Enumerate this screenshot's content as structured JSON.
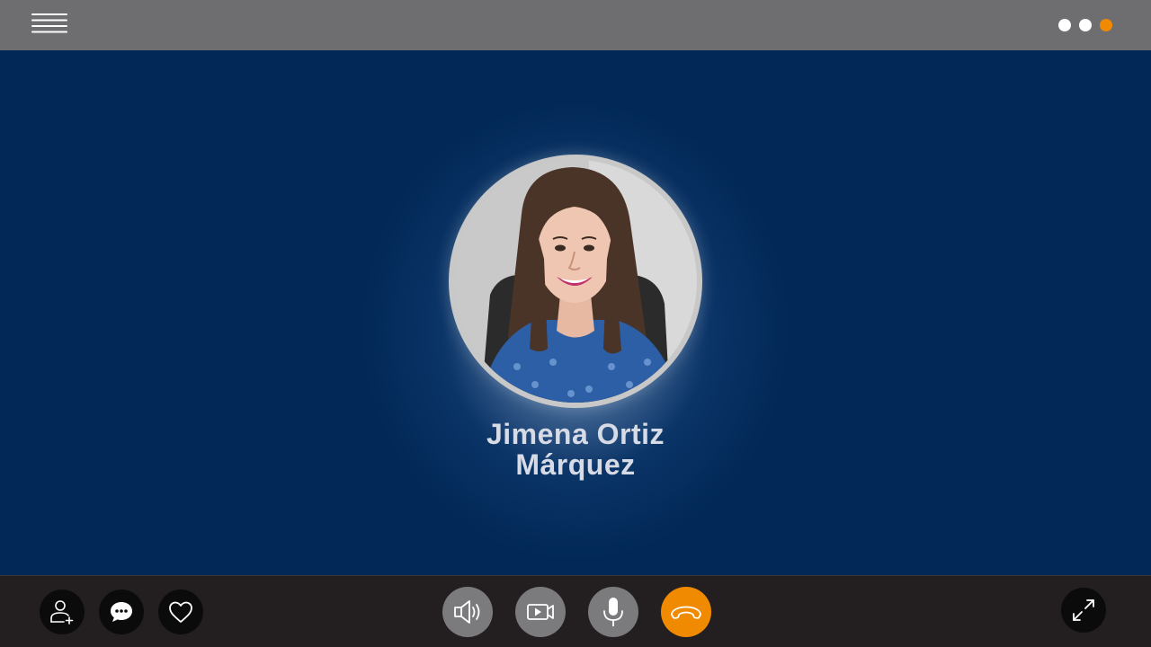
{
  "top_bar": {
    "menu_icon": "hamburger-icon",
    "page_indicator": {
      "dots": [
        {
          "color": "#ffffff",
          "active": false
        },
        {
          "color": "#ffffff",
          "active": false
        },
        {
          "color": "#f08a00",
          "active": true
        }
      ]
    }
  },
  "call": {
    "contact": {
      "first_line": "Jimena Ortiz",
      "second_line": "Márquez"
    }
  },
  "bottom_bar": {
    "left_actions": [
      {
        "icon": "add-contact-icon"
      },
      {
        "icon": "chat-bubble-icon"
      },
      {
        "icon": "heart-icon"
      }
    ],
    "call_controls": [
      {
        "icon": "speaker-icon"
      },
      {
        "icon": "video-camera-icon"
      },
      {
        "icon": "microphone-icon"
      },
      {
        "icon": "hang-up-phone-icon",
        "color": "#f08a00"
      }
    ],
    "right_actions": [
      {
        "icon": "expand-icon"
      }
    ]
  },
  "colors": {
    "background": "#012856",
    "top_bar": "#6e6e71",
    "bottom_bar": "#231f20",
    "accent": "#f08a00",
    "name_text": "#d6dbe6"
  }
}
